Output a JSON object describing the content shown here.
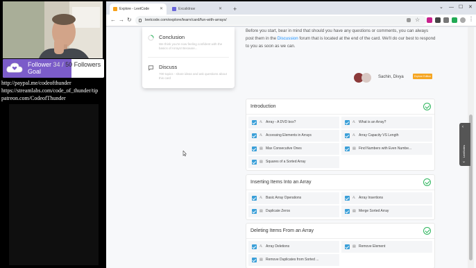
{
  "overlay": {
    "goal": {
      "title": "Follower",
      "current": "34",
      "separator": "/",
      "target": "50",
      "unit": "Followers",
      "subtitle": "Goal",
      "progress_fraction": 0.68,
      "accent": "#7b5cc9"
    },
    "links": [
      "http://paypal.me/codeofthunder",
      "https://streamlabs.com/code_of_thunder/tip",
      "patreon.com/CodeofThunder"
    ]
  },
  "browser": {
    "tabs": [
      {
        "label": "Explore - LeetCode",
        "active": true
      },
      {
        "label": "Excalidraw",
        "active": false
      }
    ],
    "new_tab": "+",
    "url": "leetcode.com/explore/learn/card/fun-with-arrays/"
  },
  "dropdown": {
    "items": [
      {
        "title": "Conclusion",
        "desc": "We think you're now feeling confident with the basics of Arrays! Because..."
      },
      {
        "title": "Discuss",
        "desc": "700 topics - share ideas and ask questions about this card"
      }
    ]
  },
  "intro": {
    "text_before": "Before you start, bear in mind that should you have any questions or comments, you can always post them in the ",
    "link": "Discussion",
    "text_after": " forum that is located at the end of the card. We'll do our best to respond to you as soon as we can."
  },
  "authors": {
    "names": "Sachin, Divya",
    "badge": "Explore Edition"
  },
  "sections": [
    {
      "title": "Introduction",
      "items": [
        {
          "kind": "A",
          "label": "Array - A DVD box?"
        },
        {
          "kind": "A",
          "label": "What is an Array?"
        },
        {
          "kind": "A",
          "label": "Accessing Elements in Arrays"
        },
        {
          "kind": "A",
          "label": "Array Capacity VS Length"
        },
        {
          "kind": "Q",
          "label": "Max Consecutive Ones"
        },
        {
          "kind": "Q",
          "label": "Find Numbers with Even Numbe..."
        },
        {
          "kind": "Q",
          "label": "Squares of a Sorted Array"
        }
      ]
    },
    {
      "title": "Inserting Items Into an Array",
      "items": [
        {
          "kind": "A",
          "label": "Basic Array Operations"
        },
        {
          "kind": "A",
          "label": "Array Insertions"
        },
        {
          "kind": "Q",
          "label": "Duplicate Zeros"
        },
        {
          "kind": "Q",
          "label": "Merge Sorted Array"
        }
      ]
    },
    {
      "title": "Deleting Items From an Array",
      "items": [
        {
          "kind": "A",
          "label": "Array Deletions"
        },
        {
          "kind": "Q",
          "label": "Remove Element"
        },
        {
          "kind": "Q",
          "label": "Remove Duplicates from Sorted ..."
        }
      ]
    }
  ],
  "sidepanel": {
    "label": "LeetNotes"
  },
  "colors": {
    "check_green": "#2db55d",
    "checkbox_blue": "#3a9fd8",
    "link_blue": "#1a90ff",
    "badge_orange": "#f5a623"
  }
}
